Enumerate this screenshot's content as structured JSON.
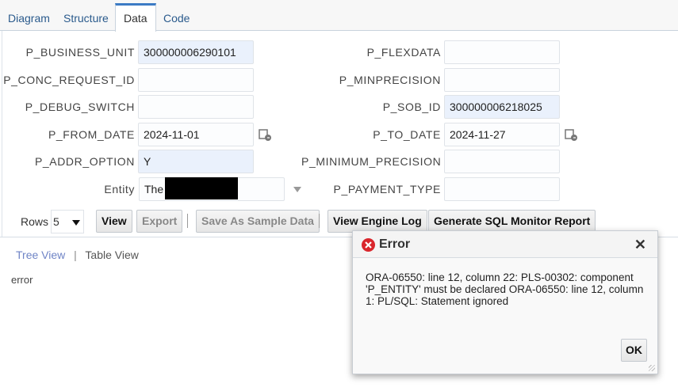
{
  "tabs": [
    {
      "label": "Diagram"
    },
    {
      "label": "Structure"
    },
    {
      "label": "Data",
      "active": true
    },
    {
      "label": "Code"
    }
  ],
  "params_left": [
    {
      "label": "P_BUSINESS_UNIT",
      "value": "300000006290101"
    },
    {
      "label": "P_CONC_REQUEST_ID",
      "value": ""
    },
    {
      "label": "P_DEBUG_SWITCH",
      "value": ""
    },
    {
      "label": "P_FROM_DATE",
      "value": "2024-11-01"
    },
    {
      "label": "P_ADDR_OPTION",
      "value": "Y"
    },
    {
      "label": "Entity",
      "value": "The"
    }
  ],
  "params_right": [
    {
      "label": "P_FLEXDATA",
      "value": ""
    },
    {
      "label": "P_MINPRECISION",
      "value": ""
    },
    {
      "label": "P_SOB_ID",
      "value": "300000006218025"
    },
    {
      "label": "P_TO_DATE",
      "value": "2024-11-27"
    },
    {
      "label": "P_MINIMUM_PRECISION",
      "value": ""
    },
    {
      "label": "P_PAYMENT_TYPE",
      "value": ""
    }
  ],
  "toolbar": {
    "rows_label": "Rows",
    "rows_value": "5",
    "view": "View",
    "export": "Export",
    "save_sample": "Save As Sample Data",
    "engine_log": "View Engine Log",
    "sql_monitor": "Generate SQL Monitor Report"
  },
  "views": {
    "tree": "Tree View",
    "sep": "|",
    "table": "Table View"
  },
  "output": "error",
  "dialog": {
    "title": "Error",
    "message": "ORA-06550: line 12, column 22: PLS-00302: component 'P_ENTITY' must be declared ORA-06550: line 12, column 1: PL/SQL: Statement ignored",
    "ok": "OK"
  },
  "colors": {
    "accent": "#3c7bc4",
    "link": "#6f84c6",
    "error": "#d9262c"
  }
}
